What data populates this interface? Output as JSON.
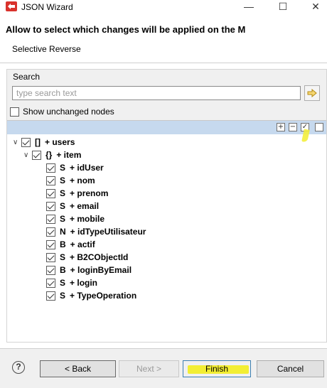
{
  "window": {
    "title": "JSON Wizard",
    "minimize": "—",
    "maximize": "☐",
    "close": "✕"
  },
  "header": {
    "title": "Allow to select which changes will be applied on the M",
    "subtitle": "Selective Reverse"
  },
  "search": {
    "label": "Search",
    "placeholder": "type search text",
    "value": ""
  },
  "show_unchanged": {
    "label": "Show unchanged nodes",
    "checked": false
  },
  "tree": {
    "toolbar": {
      "expand_all": "+",
      "collapse_all": "−",
      "check_all": "✓",
      "uncheck_all": ""
    },
    "nodes": [
      {
        "chevron": "∨",
        "type": "[]",
        "label": "+ users"
      },
      {
        "chevron": "∨",
        "type": "{}",
        "label": "+ item"
      },
      {
        "type": "S",
        "label": "+ idUser"
      },
      {
        "type": "S",
        "label": "+ nom"
      },
      {
        "type": "S",
        "label": "+ prenom"
      },
      {
        "type": "S",
        "label": "+ email"
      },
      {
        "type": "S",
        "label": "+ mobile"
      },
      {
        "type": "N",
        "label": "+ idTypeUtilisateur"
      },
      {
        "type": "B",
        "label": "+ actif"
      },
      {
        "type": "S",
        "label": "+ B2CObjectId"
      },
      {
        "type": "B",
        "label": "+ loginByEmail"
      },
      {
        "type": "S",
        "label": "+ login"
      },
      {
        "type": "S",
        "label": "+ TypeOperation"
      }
    ]
  },
  "footer": {
    "help": "?",
    "back": "< Back",
    "next": "Next >",
    "finish": "Finish",
    "cancel": "Cancel"
  },
  "colors": {
    "toolbar_bg": "#c6d9ee",
    "highlight": "#f3ee3b",
    "accent": "#3c7fb1"
  }
}
